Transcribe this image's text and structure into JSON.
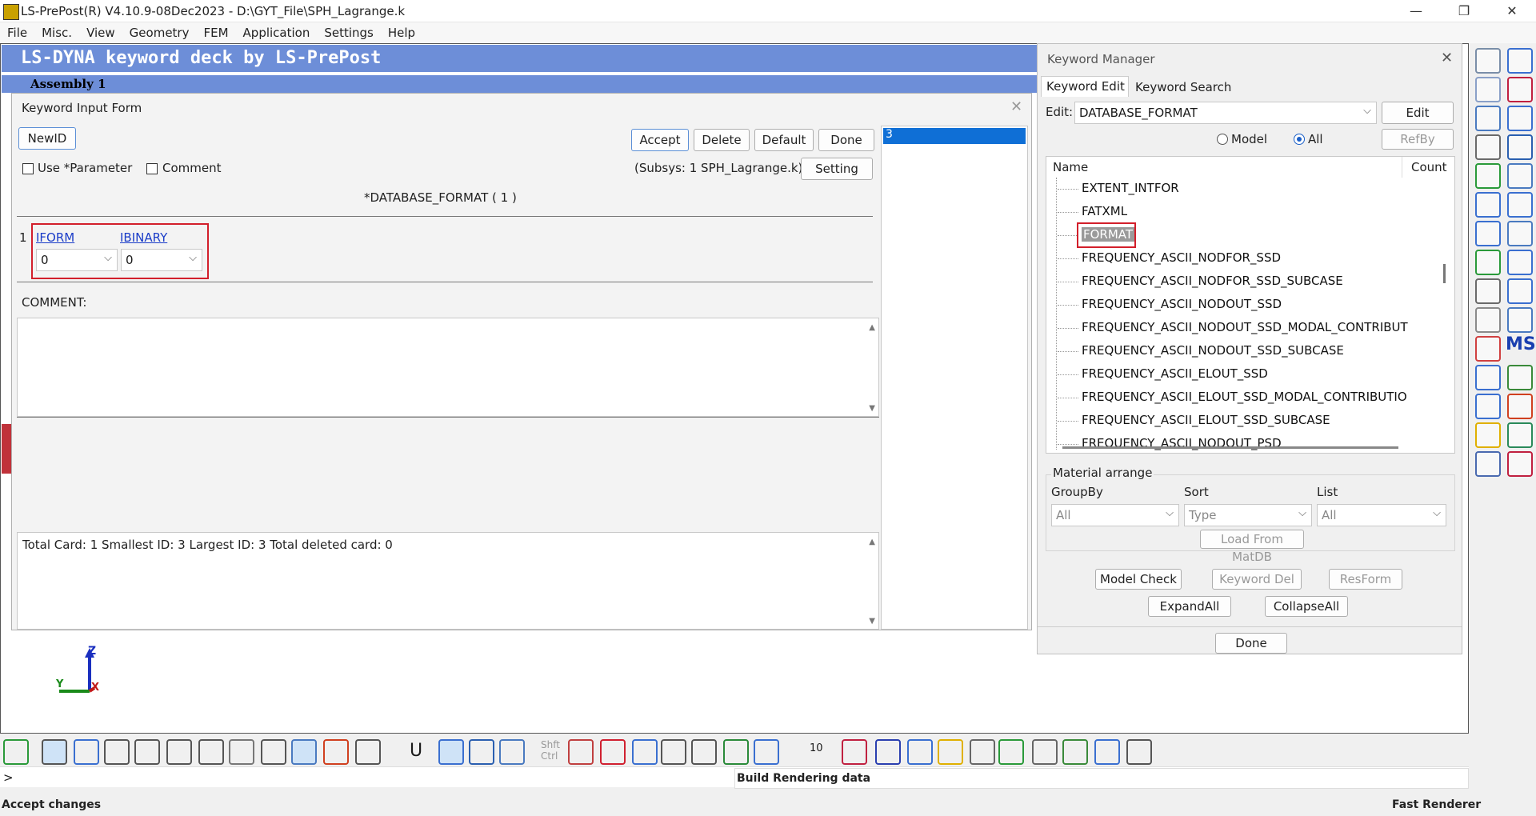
{
  "window": {
    "title": "LS-PrePost(R) V4.10.9-08Dec2023 - D:\\GYT_File\\SPH_Lagrange.k",
    "minimize": "—",
    "maximize": "❐",
    "close": "✕"
  },
  "menu": [
    "File",
    "Misc.",
    "View",
    "Geometry",
    "FEM",
    "Application",
    "Settings",
    "Help"
  ],
  "graphics": {
    "deck_title": "LS-DYNA keyword deck by LS-PrePost",
    "assembly_title": "Assembly 1",
    "axis_labels": {
      "z": "Z",
      "y": "Y",
      "x": "X"
    }
  },
  "keyword_input_form": {
    "title": "Keyword Input Form",
    "buttons": {
      "newid": "NewID",
      "accept": "Accept",
      "delete": "Delete",
      "default": "Default",
      "done": "Done",
      "setting": "Setting"
    },
    "use_parameter": "Use *Parameter",
    "comment_check": "Comment",
    "subsys": "(Subsys: 1 SPH_Lagrange.k)",
    "keyword_header": "*DATABASE_FORMAT   ( 1 )",
    "card_number": "1",
    "fields": [
      {
        "name": "IFORM",
        "value": "0"
      },
      {
        "name": "IBINARY",
        "value": "0"
      }
    ],
    "comment_label": "COMMENT:",
    "summary": "Total Card: 1     Smallest ID: 3    Largest ID: 3    Total deleted card:  0",
    "id_list": [
      "3"
    ]
  },
  "keyword_manager": {
    "title": "Keyword Manager",
    "tabs": [
      "Keyword Edit",
      "Keyword Search"
    ],
    "edit_label": "Edit:",
    "edit_value": "DATABASE_FORMAT",
    "edit_button": "Edit",
    "radio_model": "Model",
    "radio_all": "All",
    "refby": "RefBy",
    "columns": {
      "name": "Name",
      "count": "Count"
    },
    "tree_items": [
      "EXTENT_INTFOR",
      "FATXML",
      "FORMAT",
      "FREQUENCY_ASCII_NODFOR_SSD",
      "FREQUENCY_ASCII_NODFOR_SSD_SUBCASE",
      "FREQUENCY_ASCII_NODOUT_SSD",
      "FREQUENCY_ASCII_NODOUT_SSD_MODAL_CONTRIBUT",
      "FREQUENCY_ASCII_NODOUT_SSD_SUBCASE",
      "FREQUENCY_ASCII_ELOUT_SSD",
      "FREQUENCY_ASCII_ELOUT_SSD_MODAL_CONTRIBUTIO",
      "FREQUENCY_ASCII_ELOUT_SSD_SUBCASE",
      "FREQUENCY_ASCII_NODOUT_PSD"
    ],
    "material_arrange": "Material arrange",
    "groupby_label": "GroupBy",
    "sort_label": "Sort",
    "list_label": "List",
    "groupby_value": "All",
    "sort_value": "Type",
    "list_value": "All",
    "load_from_matdb": "Load From MatDB",
    "model_check": "Model Check",
    "keyword_del": "Keyword Del",
    "resform": "ResForm",
    "expand_all": "ExpandAll",
    "collapse_all": "CollapseAll",
    "done": "Done"
  },
  "bottom": {
    "prompt": ">",
    "build_status": "Build Rendering data",
    "zoom_value": "10",
    "shft_ctrl": "Shft Ctrl",
    "u_label": "U"
  },
  "status": {
    "left": "Accept changes",
    "right": "Fast Renderer"
  },
  "colors": {
    "banner": "#6d8ed8",
    "selection": "#0f6fd6",
    "highlight_box": "#d21f2b"
  }
}
